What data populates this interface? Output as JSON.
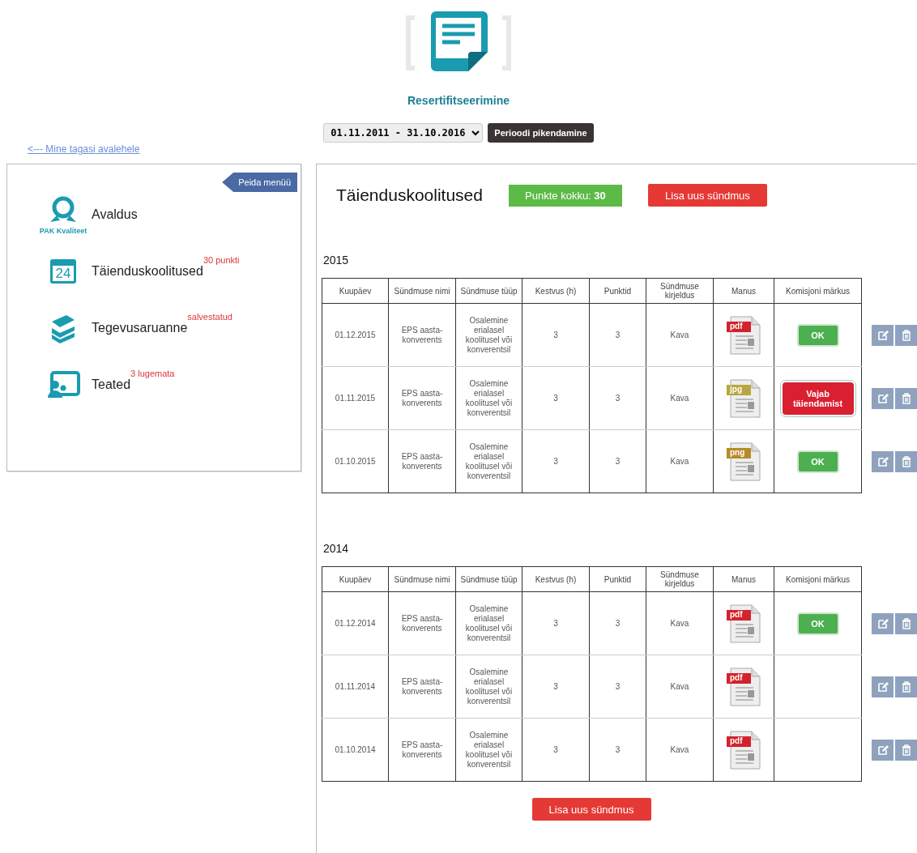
{
  "header": {
    "title": "Resertifitseerimine",
    "period": {
      "value": "01.11.2011 - 31.10.2016"
    },
    "extend_button": "Perioodi pikendamine",
    "back_link": "<--- Mine tagasi avalehele"
  },
  "sidebar": {
    "hide_button": "Peida menüü",
    "items": [
      {
        "kind": "award",
        "label": "Avaldus",
        "caption": "PAK Kvaliteet"
      },
      {
        "kind": "calendar",
        "label": "Täienduskoolitused",
        "icon_text": "24",
        "badge": "30 punkti"
      },
      {
        "kind": "books",
        "label": "Tegevusaruanne",
        "badge": "salvestatud"
      },
      {
        "kind": "board",
        "label": "Teated",
        "badge": "3 lugemata"
      }
    ]
  },
  "main": {
    "title": "Täienduskoolitused",
    "points": "Punkte kokku: **30**",
    "add_button": "Lisa uus sündmus",
    "years": [
      {
        "year": "2015",
        "columns": [
          "Kuupäev",
          "Sündmuse nimi",
          "Sündmuse tüüp",
          "Kestvus (h)",
          "Punktid",
          "Sündmuse kirjeldus",
          "Manus",
          "Komisjoni märkus"
        ],
        "rows": [
          {
            "date": "01.12.2015",
            "name": "EPS aasta-konverents",
            "type": "Osalemine erialasel koolitusel või konverentsil",
            "duration": "3",
            "points": "3",
            "description": "Kava",
            "file": "pdf",
            "remark": {
              "kind": "ok",
              "label": "OK"
            }
          },
          {
            "date": "01.11.2015",
            "name": "EPS aasta-konverents",
            "type": "Osalemine erialasel koolitusel või konverentsil",
            "duration": "3",
            "points": "3",
            "description": "Kava",
            "file": "jpg",
            "remark": {
              "kind": "incomplete",
              "label": "Vajab täiendamist"
            }
          },
          {
            "date": "01.10.2015",
            "name": "EPS aasta-konverents",
            "type": "Osalemine erialasel koolitusel või konverentsil",
            "duration": "3",
            "points": "3",
            "description": "Kava",
            "file": "png",
            "remark": {
              "kind": "ok",
              "label": "OK"
            }
          }
        ]
      },
      {
        "year": "2014",
        "columns": [
          "Kuupäev",
          "Sündmuse nimi",
          "Sündmuse tüüp",
          "Kestvus (h)",
          "Punktid",
          "Sündmuse kirjeldus",
          "Manus",
          "Komisjoni märkus"
        ],
        "rows": [
          {
            "date": "01.12.2014",
            "name": "EPS aasta-konverents",
            "type": "Osalemine erialasel koolitusel või konverentsil",
            "duration": "3",
            "points": "3",
            "description": "Kava",
            "file": "pdf",
            "remark": {
              "kind": "ok",
              "label": "OK"
            }
          },
          {
            "date": "01.11.2014",
            "name": "EPS aasta-konverents",
            "type": "Osalemine erialasel koolitusel või konverentsil",
            "duration": "3",
            "points": "3",
            "description": "Kava",
            "file": "pdf"
          },
          {
            "date": "01.10.2014",
            "name": "EPS aasta-konverents",
            "type": "Osalemine erialasel koolitusel või konverentsil",
            "duration": "3",
            "points": "3",
            "description": "Kava",
            "file": "pdf"
          }
        ]
      }
    ],
    "bottom_button": "Lisa uus sündmus"
  }
}
